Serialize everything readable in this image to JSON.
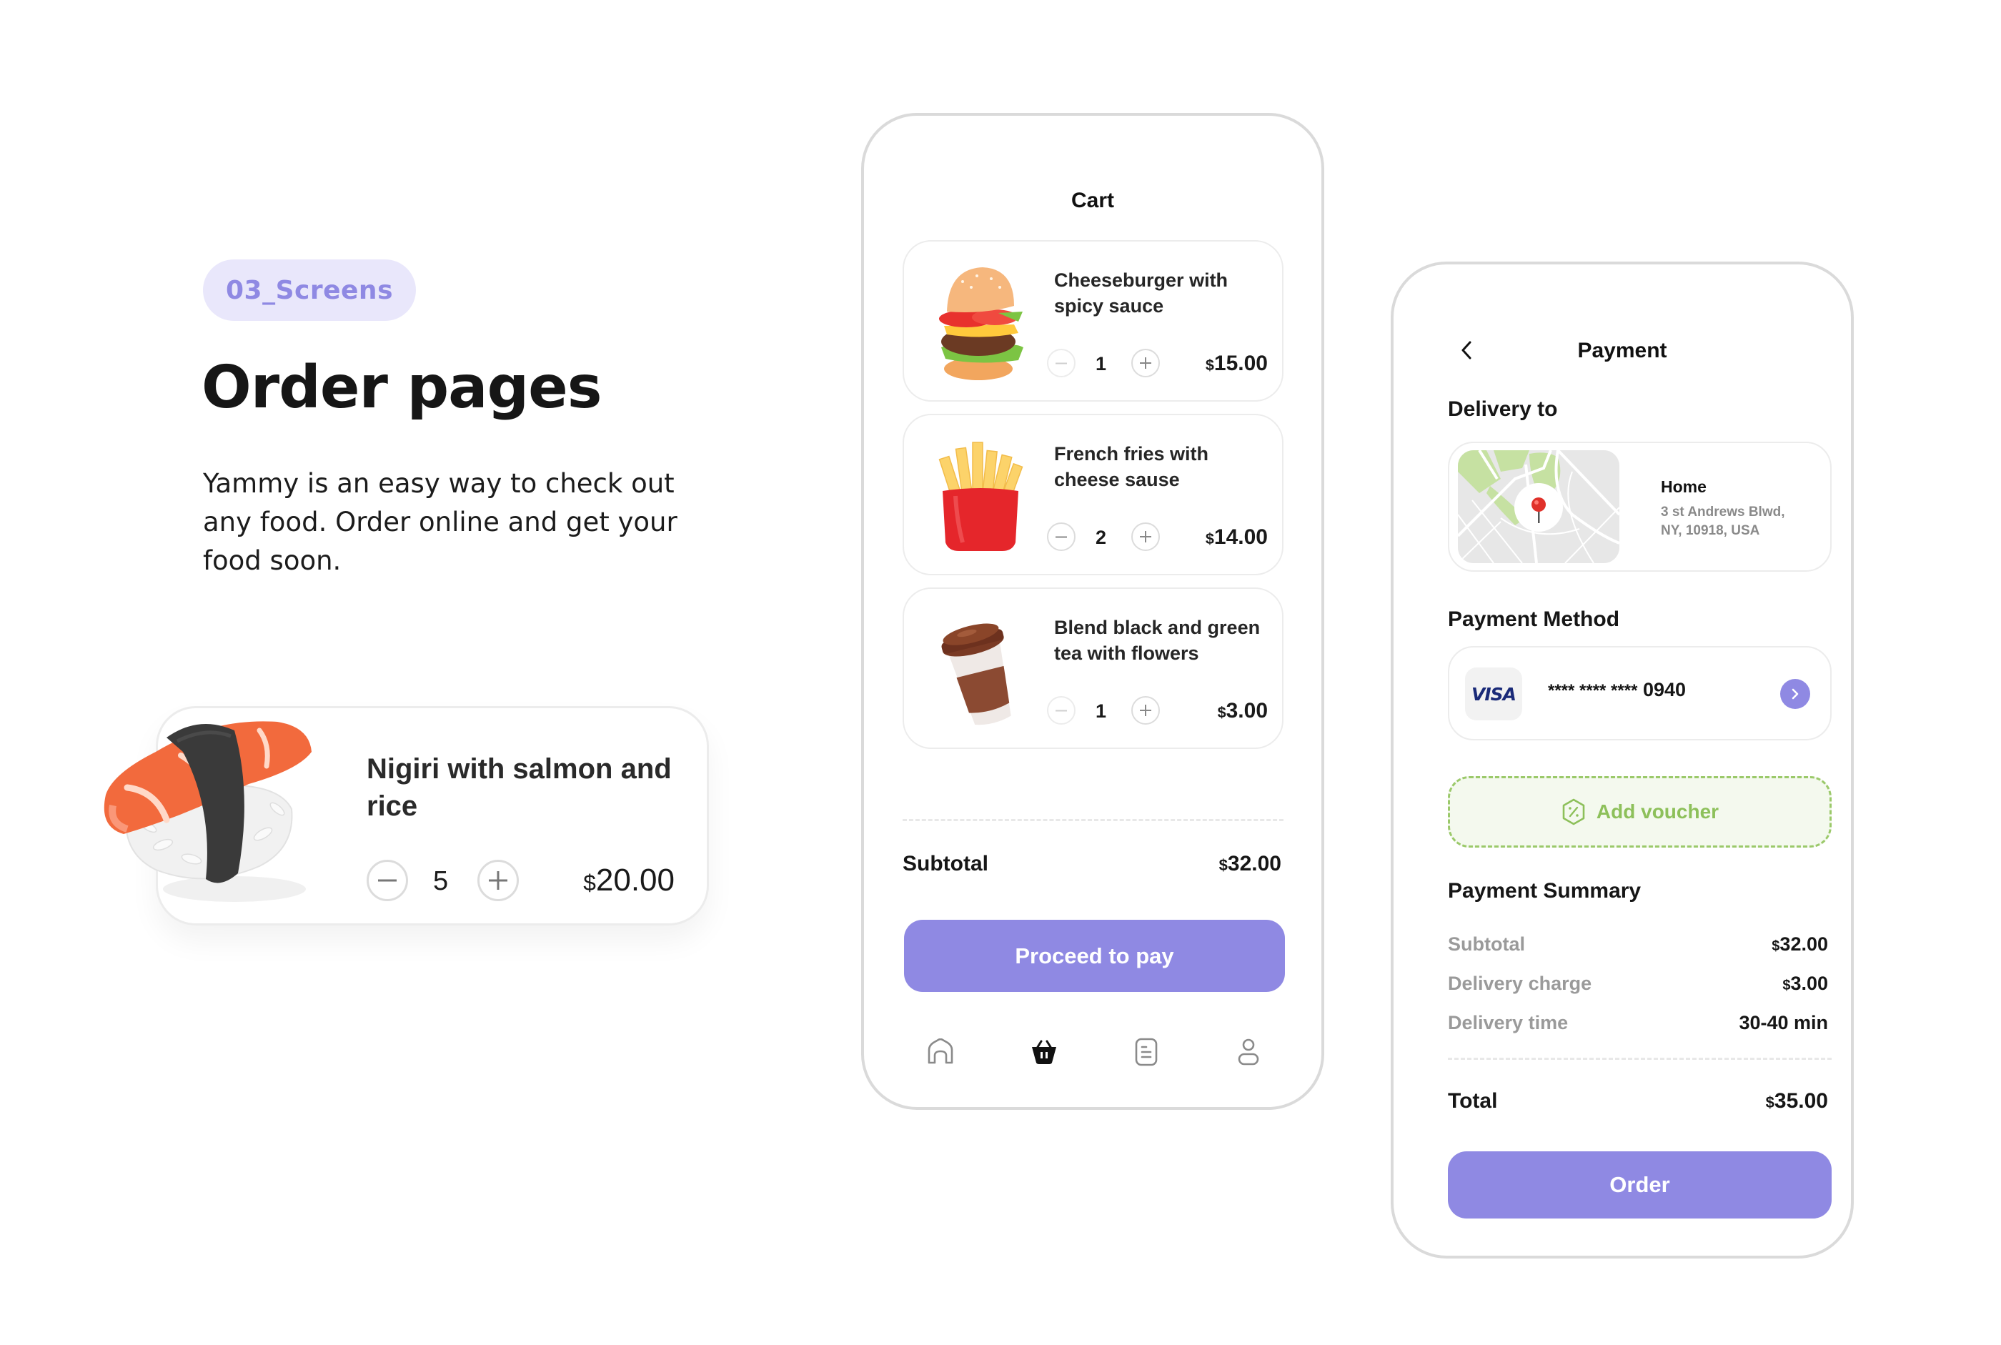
{
  "intro": {
    "badge": "03_Screens",
    "title": "Order pages",
    "description": "Yammy is an easy way to check out any food. Order online and get your food soon."
  },
  "featured_item": {
    "name": "Nigiri with salmon and rice",
    "quantity": "5",
    "currency": "$",
    "price": "20.00",
    "image": "sushi-nigiri-image"
  },
  "cart": {
    "title": "Cart",
    "items": [
      {
        "name": "Cheeseburger with spicy sauce",
        "quantity": "1",
        "currency": "$",
        "price": "15.00",
        "image": "cheeseburger-image",
        "minus_disabled": true
      },
      {
        "name": "French fries with cheese sause",
        "quantity": "2",
        "currency": "$",
        "price": "14.00",
        "image": "french-fries-image",
        "minus_disabled": false
      },
      {
        "name": "Blend black and green tea with flowers",
        "quantity": "1",
        "currency": "$",
        "price": "3.00",
        "image": "tea-cup-image",
        "minus_disabled": true
      }
    ],
    "subtotal_label": "Subtotal",
    "subtotal_currency": "$",
    "subtotal_value": "32.00",
    "proceed_label": "Proceed to pay",
    "tabs": [
      {
        "name": "home",
        "icon": "home-icon",
        "active": false
      },
      {
        "name": "cart",
        "icon": "basket-icon",
        "active": true
      },
      {
        "name": "orders",
        "icon": "document-icon",
        "active": false
      },
      {
        "name": "profile",
        "icon": "user-icon",
        "active": false
      }
    ]
  },
  "payment": {
    "title": "Payment",
    "back_icon": "chevron-left-icon",
    "delivery_title": "Delivery to",
    "address": {
      "name": "Home",
      "line1": "3 st Andrews Blwd,",
      "line2": "NY, 10918, USA"
    },
    "method_title": "Payment Method",
    "card": {
      "brand": "VISA",
      "masked": "**** **** ****",
      "last4": "0940"
    },
    "voucher_label": "Add voucher",
    "summary_title": "Payment Summary",
    "summary": [
      {
        "label": "Subtotal",
        "currency": "$",
        "value": "32.00"
      },
      {
        "label": "Delivery charge",
        "currency": "$",
        "value": "3.00"
      },
      {
        "label": "Delivery time",
        "currency": "",
        "value": "30-40 min"
      }
    ],
    "total_label": "Total",
    "total_currency": "$",
    "total_value": "35.00",
    "order_label": "Order"
  },
  "colors": {
    "accent": "#8f89e3",
    "accent_light": "#e9e7fb",
    "voucher_green": "#8dc05a",
    "voucher_bg": "#f4f9ee",
    "border": "#dadada",
    "text": "#161616",
    "muted": "#9a9a9a"
  }
}
